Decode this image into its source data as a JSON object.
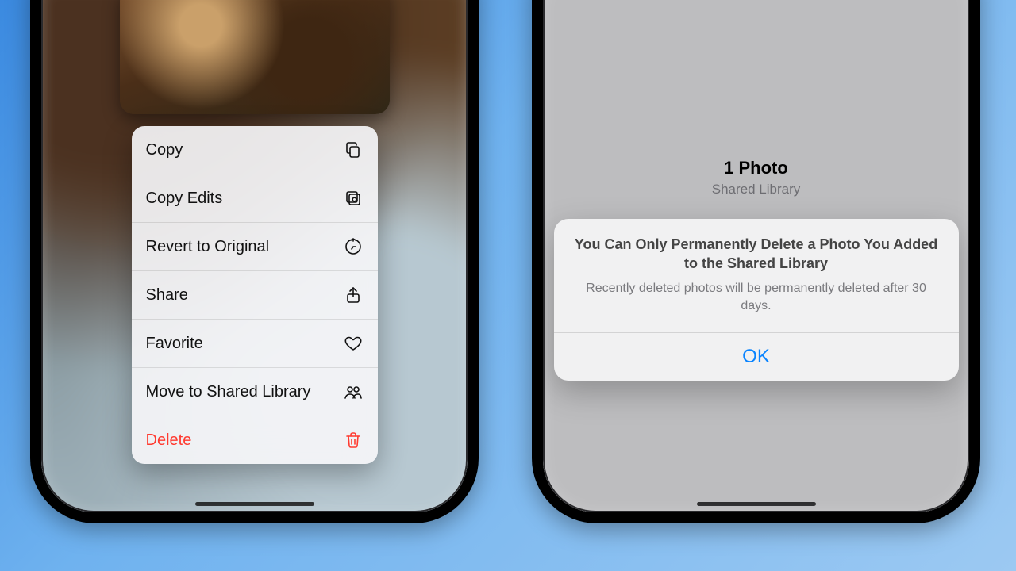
{
  "left": {
    "menu": [
      {
        "label": "Copy",
        "icon": "copy-icon",
        "destructive": false
      },
      {
        "label": "Copy Edits",
        "icon": "copy-edits-icon",
        "destructive": false
      },
      {
        "label": "Revert to Original",
        "icon": "revert-icon",
        "destructive": false
      },
      {
        "label": "Share",
        "icon": "share-icon",
        "destructive": false
      },
      {
        "label": "Favorite",
        "icon": "heart-icon",
        "destructive": false
      },
      {
        "label": "Move to Shared Library",
        "icon": "people-icon",
        "destructive": false
      },
      {
        "label": "Delete",
        "icon": "trash-icon",
        "destructive": true
      }
    ]
  },
  "right": {
    "summary_count": "1 Photo",
    "summary_sub": "Shared Library",
    "alert_title": "You Can Only Permanently Delete a Photo You Added to the Shared Library",
    "alert_message": "Recently deleted photos will be permanently deleted after 30 days.",
    "alert_button": "OK"
  }
}
